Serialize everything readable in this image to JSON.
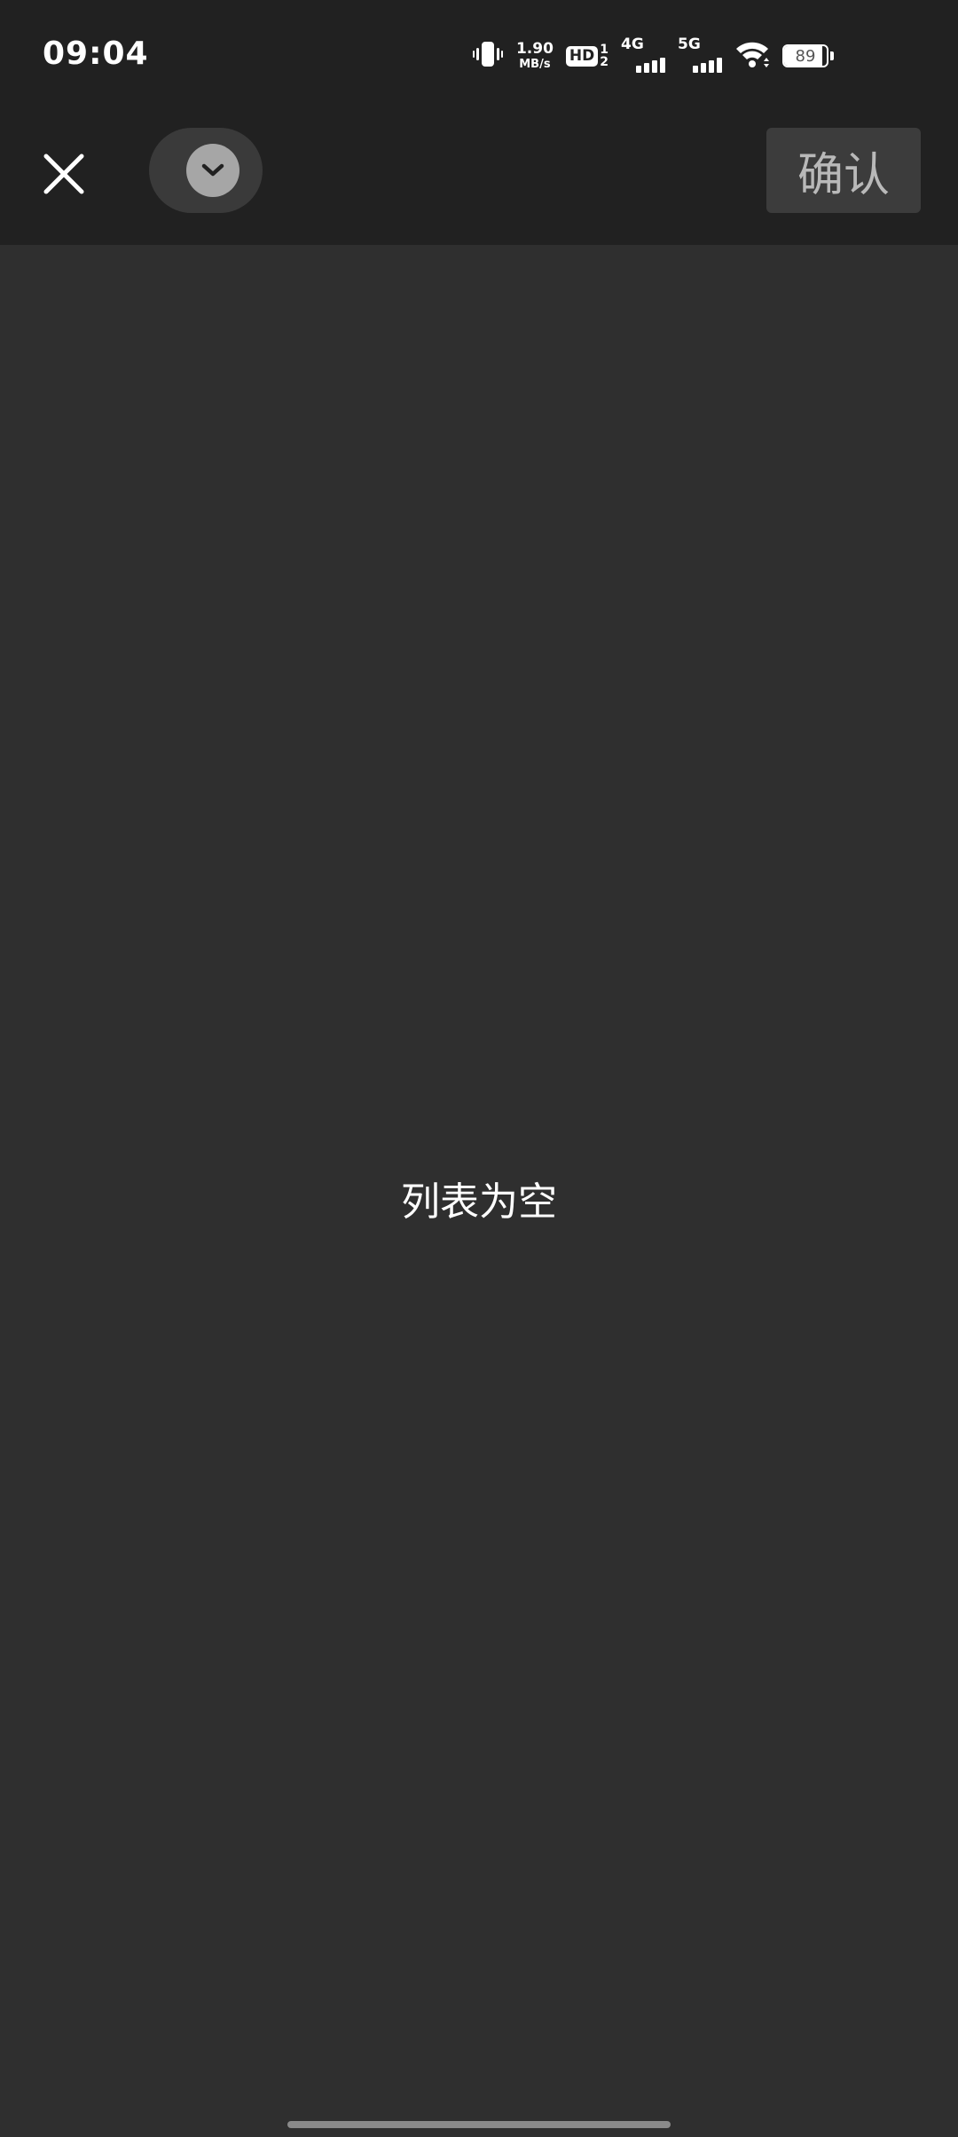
{
  "status_bar": {
    "time": "09:04",
    "net_speed_value": "1.90",
    "net_speed_unit": "MB/s",
    "hd_label": "HD",
    "hd_sub_top": "1",
    "hd_sub_bottom": "2",
    "signal_1_label": "4G",
    "signal_2_label": "5G",
    "battery_level": "89",
    "battery_fraction": 0.89,
    "icons": [
      "vibrate-icon",
      "hd-voice-icon",
      "cell-signal-icon",
      "wifi-icon",
      "battery-icon"
    ]
  },
  "toolbar": {
    "close_icon": "close-icon",
    "dropdown_icon": "chevron-down-icon",
    "confirm_label": "确认"
  },
  "content": {
    "empty_message": "列表为空"
  },
  "colors": {
    "background": "#2f2f2f",
    "bars": "#212121",
    "confirm_bg": "#3c3c3c",
    "confirm_text": "#b9b9b9",
    "dropdown_circle": "#a6a6a6"
  }
}
